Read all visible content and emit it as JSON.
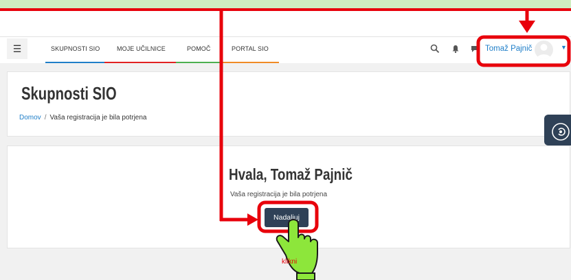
{
  "navbar": {
    "menu_icon": "hamburger-menu-icon",
    "items": [
      {
        "label": "SKUPNOSTI SIO",
        "accent": "#1e7ec8"
      },
      {
        "label": "MOJE UČILNICE",
        "accent": "#e02020"
      },
      {
        "label": "POMOČ",
        "accent": "#4caf50"
      },
      {
        "label": "PORTAL SIO",
        "accent": "#f08a24"
      }
    ],
    "icons": [
      "search-icon",
      "bell-icon",
      "chat-icon"
    ],
    "user_name": "Tomaž Pajnič",
    "avatar_icon": "user-avatar-icon",
    "dropdown_icon": "caret-down-icon"
  },
  "header": {
    "title": "Skupnosti SIO",
    "breadcrumb": {
      "home": "Domov",
      "separator": "/",
      "current": "Vaša registracija je bila potrjena"
    }
  },
  "side_tab_icon": "accessibility-icon",
  "main": {
    "heading": "Hvala, Tomaž Pajnič",
    "message": "Vaša registracija je bila potrjena",
    "continue_label": "Nadaljuj"
  },
  "annotation": {
    "hand_label": "klikni",
    "highlight_color": "#e8000b",
    "hand_color": "#8de63b"
  }
}
